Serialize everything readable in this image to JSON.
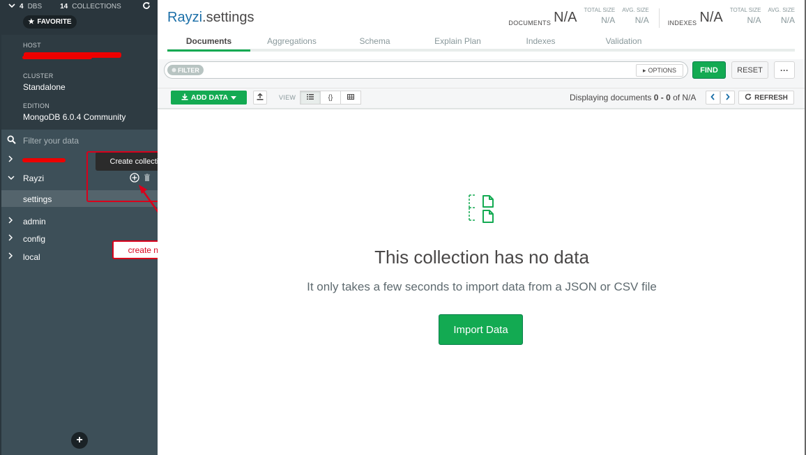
{
  "sidebar": {
    "stats": {
      "dbs_count": "4",
      "dbs_label": "DBS",
      "collections_count": "14",
      "collections_label": "COLLECTIONS"
    },
    "favorite_label": "FAVORITE",
    "instance": {
      "host_label": "HOST",
      "cluster_label": "CLUSTER",
      "cluster_value": "Standalone",
      "edition_label": "EDITION",
      "edition_value": "MongoDB 6.0.4 Community"
    },
    "filter_placeholder": "Filter your data",
    "databases": [
      {
        "name": "Rayzi",
        "expanded": true,
        "collections": [
          "settings"
        ]
      },
      {
        "name": "admin",
        "expanded": false
      },
      {
        "name": "config",
        "expanded": false
      },
      {
        "name": "local",
        "expanded": false
      }
    ],
    "tooltip": "Create collection",
    "annotation": "create new collection from here",
    "add_db_label": "+"
  },
  "header": {
    "db_name": "Rayzi",
    "coll_name": ".settings",
    "documents_label": "DOCUMENTS",
    "documents_value": "N/A",
    "total_size_label": "TOTAL SIZE",
    "total_size_value": "N/A",
    "avg_size_label": "AVG. SIZE",
    "avg_size_value": "N/A",
    "indexes_label": "INDEXES",
    "indexes_value": "N/A",
    "idx_total_size_label": "TOTAL SIZE",
    "idx_total_size_value": "N/A",
    "idx_avg_size_label": "AVG. SIZE",
    "idx_avg_size_value": "N/A"
  },
  "tabs": [
    "Documents",
    "Aggregations",
    "Schema",
    "Explain Plan",
    "Indexes",
    "Validation"
  ],
  "active_tab": "Documents",
  "query": {
    "filter_label": "FILTER",
    "options_label": "OPTIONS",
    "find_label": "FIND",
    "reset_label": "RESET",
    "more_label": "···"
  },
  "toolbar": {
    "add_data_label": "ADD DATA",
    "view_label": "VIEW",
    "paging_prefix": "Displaying documents ",
    "paging_range": "0 - 0",
    "paging_suffix": " of N/A",
    "refresh_label": "REFRESH"
  },
  "empty_state": {
    "title": "This collection has no data",
    "subtitle": "It only takes a few seconds to import data from a JSON or CSV file",
    "import_label": "Import Data"
  },
  "colors": {
    "accent_green": "#13aa52",
    "link_blue": "#1b6fa8",
    "sidebar_bg": "#3d4f58",
    "annotation_red": "#d9001b"
  },
  "icons": [
    "chevron-down-icon",
    "refresh-icon",
    "star-icon",
    "search-icon",
    "chevron-right-icon",
    "add-circle-icon",
    "trash-icon",
    "download-icon",
    "export-icon",
    "list-view-icon",
    "json-view-icon",
    "table-view-icon",
    "empty-documents-icon"
  ]
}
